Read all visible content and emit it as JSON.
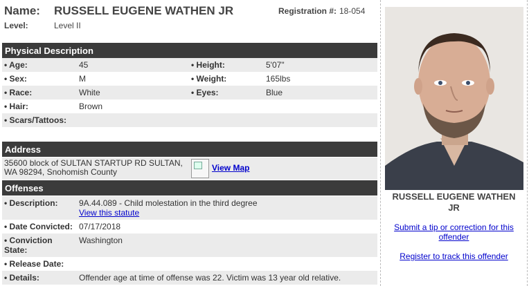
{
  "header": {
    "name_label": "Name:",
    "name": "RUSSELL EUGENE WATHEN JR",
    "registration_label": "Registration #:",
    "registration": "18-054",
    "level_label": "Level:",
    "level": "Level II"
  },
  "physical": {
    "title": "Physical Description",
    "age_label": "• Age:",
    "age": "45",
    "height_label": "• Height:",
    "height": "5'07\"",
    "sex_label": "• Sex:",
    "sex": "M",
    "weight_label": "• Weight:",
    "weight": "165lbs",
    "race_label": "• Race:",
    "race": "White",
    "eyes_label": "• Eyes:",
    "eyes": "Blue",
    "hair_label": "• Hair:",
    "hair": "Brown",
    "scars_label": "• Scars/Tattoos:",
    "scars": ""
  },
  "address": {
    "title": "Address",
    "line1": "35600 block of SULTAN STARTUP RD SULTAN,",
    "line2": "WA 98294, Snohomish County",
    "map_link": "View Map"
  },
  "offenses": {
    "title": "Offenses",
    "description_label": "• Description:",
    "description": "9A.44.089 - Child molestation in the third degree",
    "statute_link": "View this statute",
    "date_label": "• Date Convicted:",
    "date": "07/17/2018",
    "state_label_1": "• Conviction",
    "state_label_2": "State:",
    "state": "Washington",
    "release_label": "• Release Date:",
    "release": "",
    "details_label": "• Details:",
    "details": "Offender age at time of offense was 22. Victim was 13 year old relative."
  },
  "sidebar": {
    "name_line1": "RUSSELL EUGENE WATHEN",
    "name_line2": "JR",
    "tip_link_1": "Submit a tip or correction for this",
    "tip_link_2": "offender",
    "track_link": "Register to track this offender"
  },
  "colors": {
    "section_header": "#3b3b3b",
    "row_shade": "#ebebeb",
    "link": "#0000cc"
  }
}
